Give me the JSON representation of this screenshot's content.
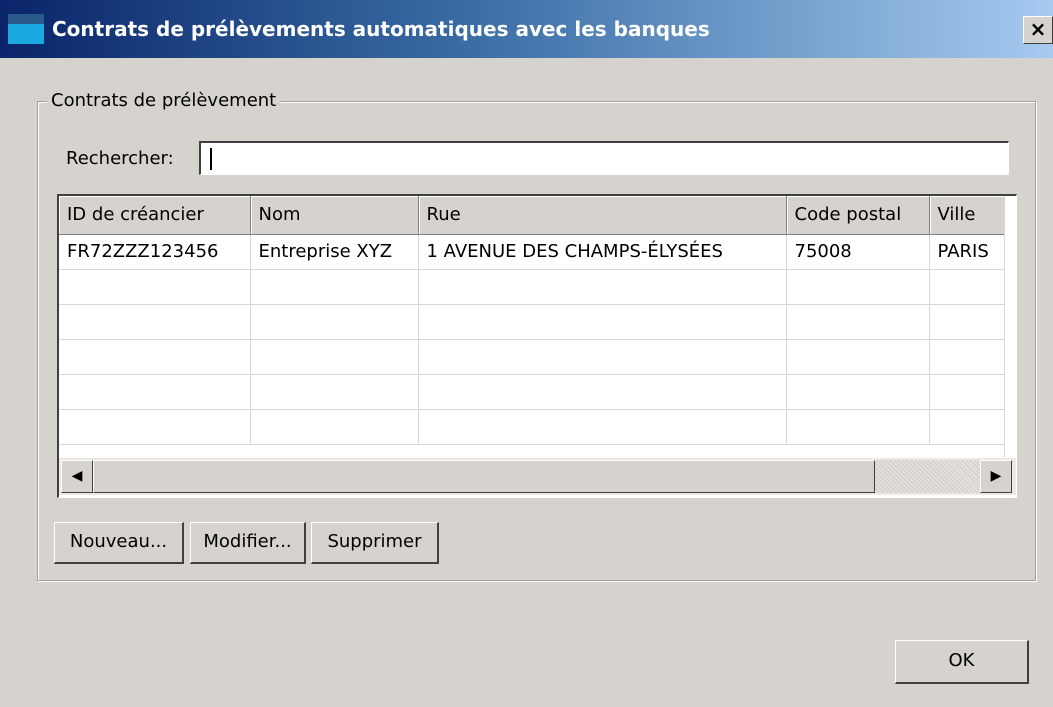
{
  "window": {
    "title": "Contrats de prélèvements automatiques avec les banques",
    "close_label": "×"
  },
  "group": {
    "legend": "Contrats de prélèvement"
  },
  "search": {
    "label": "Rechercher:",
    "value": "",
    "placeholder": ""
  },
  "table": {
    "columns": [
      "ID de créancier",
      "Nom",
      "Rue",
      "Code postal",
      "Ville"
    ],
    "rows": [
      [
        "FR72ZZZ123456",
        "Entreprise XYZ",
        "1 AVENUE DES CHAMPS-ÉLYSÉES",
        "75008",
        "PARIS"
      ]
    ]
  },
  "scrollbar": {
    "left_arrow": "◀",
    "right_arrow": "▶"
  },
  "buttons": {
    "new": "Nouveau...",
    "edit": "Modifier...",
    "delete": "Supprimer",
    "ok": "OK"
  },
  "colors": {
    "titlebar_start": "#0a246a",
    "titlebar_end": "#a6caf0",
    "window_bg": "#d6d3ce"
  }
}
